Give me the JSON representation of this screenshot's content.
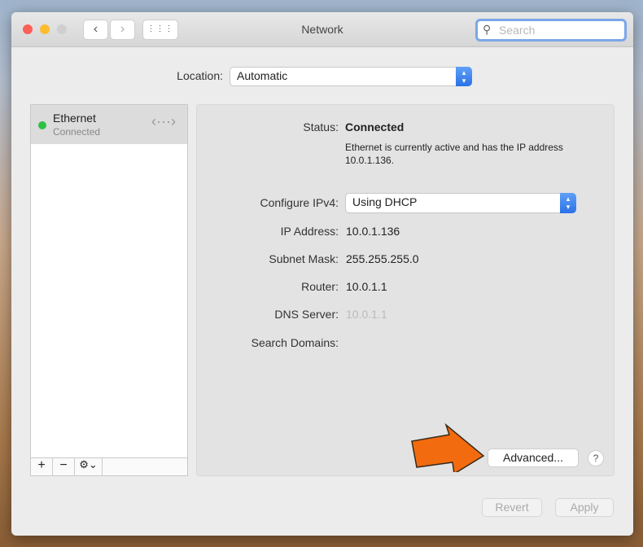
{
  "window": {
    "title": "Network",
    "search_placeholder": "Search"
  },
  "location": {
    "label": "Location:",
    "value": "Automatic"
  },
  "sidebar": {
    "items": [
      {
        "name": "Ethernet",
        "status": "Connected",
        "status_color": "#2fc043"
      }
    ]
  },
  "sidebar_toolbar": {
    "add": "+",
    "remove": "−",
    "gear": "⚙︎⌄"
  },
  "details": {
    "status_label": "Status:",
    "status_value": "Connected",
    "status_desc": "Ethernet is currently active and has the IP address 10.0.1.136.",
    "configure_label": "Configure IPv4:",
    "configure_value": "Using DHCP",
    "ip_label": "IP Address:",
    "ip_value": "10.0.1.136",
    "subnet_label": "Subnet Mask:",
    "subnet_value": "255.255.255.0",
    "router_label": "Router:",
    "router_value": "10.0.1.1",
    "dns_label": "DNS Server:",
    "dns_value": "10.0.1.1",
    "domains_label": "Search Domains:"
  },
  "buttons": {
    "advanced": "Advanced...",
    "help": "?",
    "revert": "Revert",
    "apply": "Apply"
  },
  "colors": {
    "accent": "#2a72e6",
    "arrow": "#f26b0f"
  }
}
